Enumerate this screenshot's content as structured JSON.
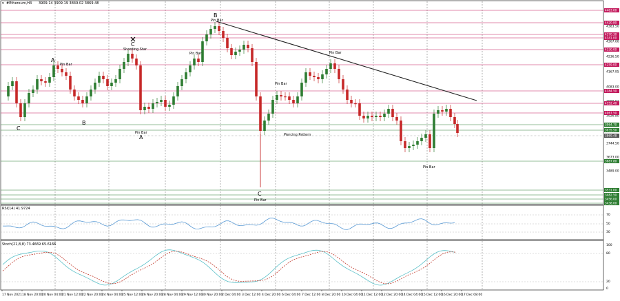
{
  "header": {
    "symbol_label": "#Ethereum,H4",
    "ohlc": "3909.14 3909.19 3849.02 3869.48"
  },
  "rsi": {
    "label": "RSI(14) 41.9724",
    "levels": [
      "70",
      "50",
      "30"
    ]
  },
  "stoch": {
    "label": "Stoch(21,8,8) 73.4669 65.6166",
    "levels": [
      "100",
      "80",
      "20",
      "0"
    ]
  },
  "colors": {
    "bull": "#2e7d32",
    "bear": "#c62828",
    "resistance": "#c2185b",
    "support": "#2e7d32",
    "trendline": "#222222",
    "rsi_line": "#5b9bd5",
    "stoch_main": "#5bc0c8",
    "stoch_signal": "#c0392b"
  },
  "price_axis": {
    "ticks": [
      "4482.00",
      "4383.50",
      "4307.00",
      "4236.50",
      "4167.95",
      "4083.00",
      "3999.61",
      "3926.80",
      "3850.00",
      "3744.50",
      "3673.00",
      "3489.00"
    ]
  },
  "price_tags": {
    "resistance": [
      "4463.00",
      "4420.80",
      "4370.30",
      "4341.00",
      "4330.00",
      "4259.00",
      "4184.50",
      "4152.40",
      "4067.50"
    ],
    "support": [
      "3964.70",
      "3935.50",
      "3869.48",
      "3687.80",
      "3531.00",
      "3482.50",
      "3456.00",
      "3438.00"
    ]
  },
  "time_axis": {
    "labels": [
      "17 Nov 2021",
      "18 Nov 20:00",
      "20 Nov 04:00",
      "21 Nov 12:00",
      "22 Nov 20:00",
      "24 Nov 04:00",
      "25 Nov 12:00",
      "26 Nov 20:00",
      "28 Nov 04:00",
      "29 Nov 12:00",
      "30 Nov 20:00",
      "2 Dec 04:00",
      "3 Dec 12:00",
      "4 Dec 20:00",
      "6 Dec 04:00",
      "7 Dec 12:00",
      "8 Dec 20:00",
      "10 Dec 04:00",
      "11 Dec 12:00",
      "12 Dec 20:00",
      "14 Dec 04:00",
      "15 Dec 12:00",
      "16 Dec 20:00",
      "17 Dec 08:00"
    ]
  },
  "annotations": [
    {
      "text": "A",
      "style": "big"
    },
    {
      "text": "Pin Bar",
      "style": "ann"
    },
    {
      "text": "C",
      "style": "big"
    },
    {
      "text": "B",
      "style": "big"
    },
    {
      "text": "C",
      "style": "big"
    },
    {
      "text": "Shooting Star",
      "style": "ann"
    },
    {
      "text": "Pin Bar",
      "style": "ann"
    },
    {
      "text": "A",
      "style": "big"
    },
    {
      "text": "Pin Bar",
      "style": "ann"
    },
    {
      "text": "B",
      "style": "big"
    },
    {
      "text": "Pin Bar",
      "style": "ann"
    },
    {
      "text": "Pin Bar",
      "style": "ann"
    },
    {
      "text": "Piercing Pattern",
      "style": "ann"
    },
    {
      "text": "C",
      "style": "big"
    },
    {
      "text": "Pin Bar",
      "style": "ann"
    },
    {
      "text": "Pin Bar",
      "style": "ann"
    },
    {
      "text": "Pin Bar",
      "style": "ann"
    }
  ]
}
